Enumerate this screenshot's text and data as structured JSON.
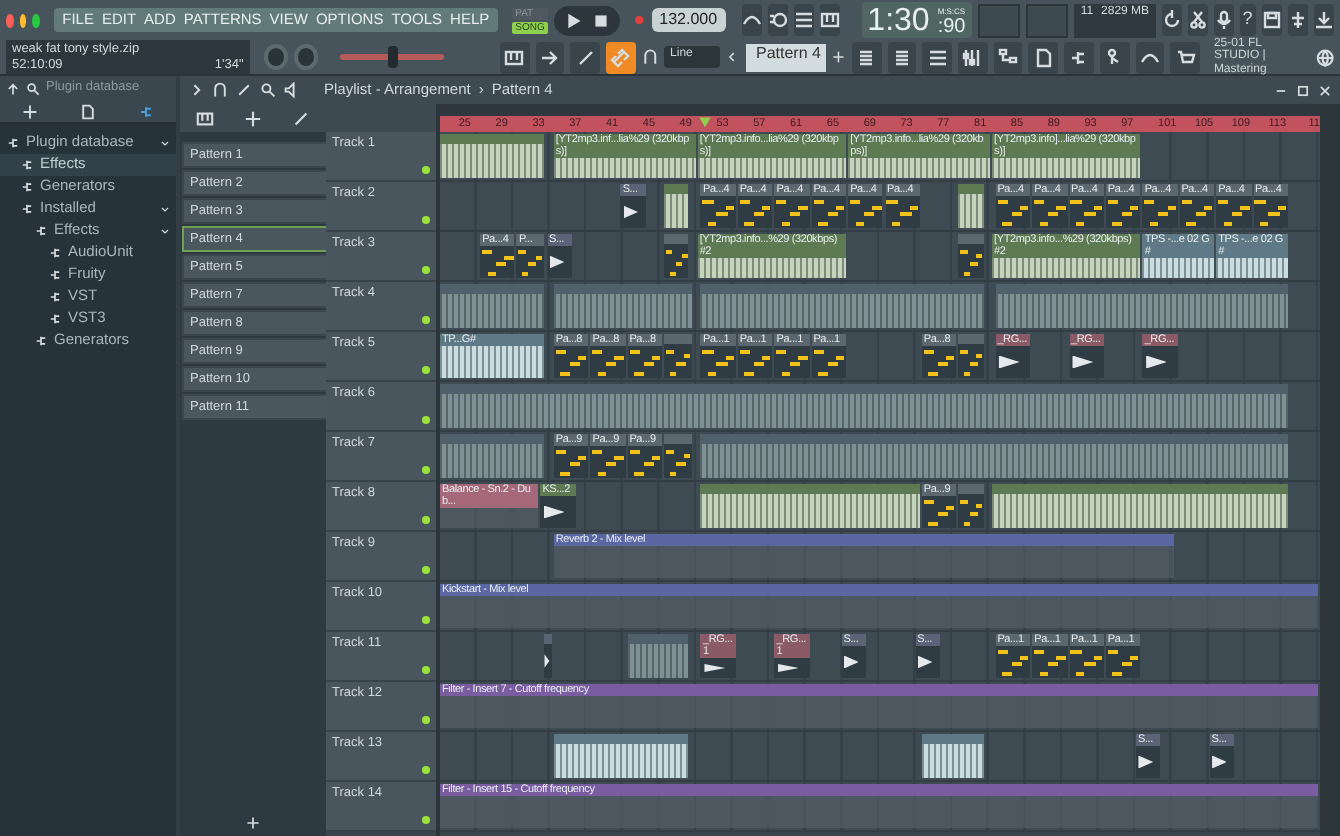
{
  "menu": [
    "FILE",
    "EDIT",
    "ADD",
    "PATTERNS",
    "VIEW",
    "OPTIONS",
    "TOOLS",
    "HELP"
  ],
  "modes": [
    {
      "label": "PAT",
      "selected": false
    },
    {
      "label": "SONG",
      "selected": true
    }
  ],
  "tempo": "132.000",
  "time": {
    "main": "1:30",
    "sub": ":90",
    "unit": "M:S:CS"
  },
  "monitor": {
    "cpu": "11",
    "memory": "2829 MB"
  },
  "help_glyph": "?",
  "hint_panel": {
    "title": "weak fat tony style.zip",
    "time": "52:10:09",
    "length": "1'34\""
  },
  "master_pitch": {
    "level": 0.5
  },
  "snap_tools": [
    {
      "on": false
    },
    {
      "on": false
    },
    {
      "on": false
    },
    {
      "on": true
    }
  ],
  "snap": {
    "value": "Line"
  },
  "pattern_selector": {
    "value": "Pattern 4"
  },
  "news": {
    "title": "25-01 FL STUDIO |",
    "subtitle": "Mastering"
  },
  "browser": {
    "breadcrumb": "Plugin database",
    "tree": [
      {
        "label": "Plugin database",
        "expanded": true,
        "selected": false,
        "children": [
          {
            "label": "Effects",
            "selected": true
          },
          {
            "label": "Generators",
            "selected": false
          },
          {
            "label": "Installed",
            "expanded": true,
            "selected": false,
            "children": [
              {
                "label": "Effects",
                "expanded": true,
                "selected": false,
                "children": [
                  {
                    "label": "AudioUnit",
                    "selected": false
                  },
                  {
                    "label": "Fruity",
                    "selected": false
                  },
                  {
                    "label": "VST",
                    "selected": false
                  },
                  {
                    "label": "VST3",
                    "selected": false
                  }
                ]
              },
              {
                "label": "Generators",
                "selected": false
              }
            ]
          }
        ]
      }
    ]
  },
  "playlist": {
    "title": "Playlist - Arrangement",
    "separator": "›",
    "pattern": "Pattern 4",
    "patterns": [
      {
        "label": "Pattern 1",
        "selected": false
      },
      {
        "label": "Pattern 2",
        "selected": false
      },
      {
        "label": "Pattern 3",
        "selected": false
      },
      {
        "label": "Pattern 4",
        "selected": true
      },
      {
        "label": "Pattern 5",
        "selected": false
      },
      {
        "label": "Pattern 7",
        "selected": false
      },
      {
        "label": "Pattern 8",
        "selected": false
      },
      {
        "label": "Pattern 9",
        "selected": false
      },
      {
        "label": "Pattern 10",
        "selected": false
      },
      {
        "label": "Pattern 11",
        "selected": false
      }
    ],
    "ruler": [
      "25",
      "29",
      "33",
      "37",
      "41",
      "45",
      "49",
      "53",
      "57",
      "61",
      "65",
      "69",
      "73",
      "77",
      "81",
      "85",
      "89",
      "93",
      "97",
      "101",
      "105",
      "109",
      "113",
      "11"
    ],
    "tracks": [
      {
        "name": "Track 1",
        "enabled": true,
        "clips": [
          {
            "kind": "audio",
            "color": "#5d7a52"
          },
          {
            "kind": "audio",
            "color": "#5d7a52",
            "label": "[YT2mp3.inf...lia%29 (320kbps)]"
          },
          {
            "kind": "audio",
            "color": "#5d7a52",
            "label": "[YT2mp3.info...lia%29 (320kbps)]"
          },
          {
            "kind": "audio",
            "color": "#5d7a52",
            "label": "[YT2mp3.info...lia%29 (320kbps)]"
          },
          {
            "kind": "audio",
            "color": "#5d7a52",
            "label": "[YT2mp3.info]...lia%29 (320kbps)]"
          }
        ]
      },
      {
        "name": "Track 2",
        "enabled": true,
        "clips": [
          {
            "kind": "sample",
            "color": "#5a6476",
            "label": "S..."
          },
          {
            "kind": "audio",
            "color": "#5d7a52"
          },
          {
            "kind": "pattern",
            "color": "#5c6870",
            "label": "Pa...4"
          },
          {
            "kind": "pattern",
            "color": "#5c6870",
            "label": "Pa...4"
          },
          {
            "kind": "pattern",
            "color": "#5c6870",
            "label": "Pa...4"
          },
          {
            "kind": "pattern",
            "color": "#5c6870",
            "label": "Pa...4"
          },
          {
            "kind": "pattern",
            "color": "#5c6870",
            "label": "Pa...4"
          },
          {
            "kind": "pattern",
            "color": "#5c6870",
            "label": "Pa...4"
          },
          {
            "kind": "audio",
            "color": "#5d7a52"
          },
          {
            "kind": "pattern",
            "color": "#5c6870",
            "label": "Pa...4"
          },
          {
            "kind": "pattern",
            "color": "#5c6870",
            "label": "Pa...4"
          },
          {
            "kind": "pattern",
            "color": "#5c6870",
            "label": "Pa...4"
          },
          {
            "kind": "pattern",
            "color": "#5c6870",
            "label": "Pa...4"
          },
          {
            "kind": "pattern",
            "color": "#5c6870",
            "label": "Pa...4"
          },
          {
            "kind": "pattern",
            "color": "#5c6870",
            "label": "Pa...4"
          },
          {
            "kind": "pattern",
            "color": "#5c6870",
            "label": "Pa...4"
          },
          {
            "kind": "pattern",
            "color": "#5c6870",
            "label": "Pa...4"
          }
        ]
      },
      {
        "name": "Track 3",
        "enabled": true,
        "clips": [
          {
            "kind": "pattern",
            "color": "#5c6870",
            "label": "Pa...4"
          },
          {
            "kind": "pattern",
            "color": "#5c6870",
            "label": "P..."
          },
          {
            "kind": "sample",
            "color": "#5a6476",
            "label": "S..."
          },
          {
            "kind": "pattern",
            "color": "#5c6870"
          },
          {
            "kind": "audio",
            "color": "#5d7a52",
            "label": "[YT2mp3.info...%29 (320kbps) #2"
          },
          {
            "kind": "pattern",
            "color": "#5c6870"
          },
          {
            "kind": "audio",
            "color": "#5d7a52",
            "label": "[YT2mp3.info...%29 (320kbps) #2"
          },
          {
            "kind": "audio",
            "color": "#5f7a86",
            "label": "TPS -...e 02 G#"
          },
          {
            "kind": "audio",
            "color": "#5f7a86",
            "label": "TPS -...e 02 G#"
          }
        ]
      },
      {
        "name": "Track 4",
        "enabled": true,
        "clips": [
          {
            "kind": "audio",
            "color": "#50616b"
          },
          {
            "kind": "audio",
            "color": "#50616b"
          },
          {
            "kind": "audio",
            "color": "#50616b"
          },
          {
            "kind": "audio",
            "color": "#50616b"
          }
        ]
      },
      {
        "name": "Track 5",
        "enabled": true,
        "clips": [
          {
            "kind": "audio",
            "color": "#5f7a86",
            "label": "TP...G#"
          },
          {
            "kind": "pattern",
            "color": "#5c6870",
            "label": "Pa...8"
          },
          {
            "kind": "pattern",
            "color": "#5c6870",
            "label": "Pa...8"
          },
          {
            "kind": "pattern",
            "color": "#5c6870",
            "label": "Pa...8"
          },
          {
            "kind": "pattern",
            "color": "#5c6870"
          },
          {
            "kind": "pattern",
            "color": "#5c6870",
            "label": "Pa...1"
          },
          {
            "kind": "pattern",
            "color": "#5c6870",
            "label": "Pa...1"
          },
          {
            "kind": "pattern",
            "color": "#5c6870",
            "label": "Pa...1"
          },
          {
            "kind": "pattern",
            "color": "#5c6870",
            "label": "Pa...1"
          },
          {
            "kind": "pattern",
            "color": "#5c6870",
            "label": "Pa...8"
          },
          {
            "kind": "pattern",
            "color": "#5c6870"
          },
          {
            "kind": "sample",
            "color": "#8a5a66",
            "label": "_RG..."
          },
          {
            "kind": "sample",
            "color": "#8a5a66",
            "label": "_RG..."
          },
          {
            "kind": "sample",
            "color": "#8a5a66",
            "label": "_RG..."
          }
        ]
      },
      {
        "name": "Track 6",
        "enabled": true,
        "clips": [
          {
            "kind": "audio",
            "color": "#50616b"
          }
        ]
      },
      {
        "name": "Track 7",
        "enabled": true,
        "clips": [
          {
            "kind": "audio",
            "color": "#50616b"
          },
          {
            "kind": "pattern",
            "color": "#5c6870",
            "label": "Pa...9"
          },
          {
            "kind": "pattern",
            "color": "#5c6870",
            "label": "Pa...9"
          },
          {
            "kind": "pattern",
            "color": "#5c6870",
            "label": "Pa...9"
          },
          {
            "kind": "pattern",
            "color": "#5c6870"
          },
          {
            "kind": "audio",
            "color": "#50616b"
          }
        ]
      },
      {
        "name": "Track 8",
        "enabled": true,
        "clips": [
          {
            "kind": "automation",
            "color": "#a5677a",
            "label": "Balance - Sn.2 - Dub..."
          },
          {
            "kind": "sample",
            "color": "#5d7a52",
            "label": "KS...2"
          },
          {
            "kind": "audio",
            "color": "#5d7a52"
          },
          {
            "kind": "pattern",
            "color": "#5c6870",
            "label": "Pa...9"
          },
          {
            "kind": "pattern",
            "color": "#5c6870"
          },
          {
            "kind": "audio",
            "color": "#5d7a52"
          }
        ]
      },
      {
        "name": "Track 9",
        "enabled": true,
        "clips": [
          {
            "kind": "automation",
            "color": "#5a67a3",
            "label": "Reverb 2 - Mix level"
          }
        ]
      },
      {
        "name": "Track 10",
        "enabled": true,
        "clips": [
          {
            "kind": "automation",
            "color": "#5a67a3",
            "label": "Kickstart - Mix level"
          }
        ]
      },
      {
        "name": "Track 11",
        "enabled": true,
        "clips": [
          {
            "kind": "sample",
            "color": "#5a6476"
          },
          {
            "kind": "audio",
            "color": "#50616b"
          },
          {
            "kind": "sample",
            "color": "#8a5a66",
            "label": "_RG...1"
          },
          {
            "kind": "sample",
            "color": "#8a5a66",
            "label": "_RG...1"
          },
          {
            "kind": "sample",
            "color": "#5a6476",
            "label": "S..."
          },
          {
            "kind": "sample",
            "color": "#5a6476",
            "label": "S..."
          },
          {
            "kind": "pattern",
            "color": "#5c6870",
            "label": "Pa...1"
          },
          {
            "kind": "pattern",
            "color": "#5c6870",
            "label": "Pa...1"
          },
          {
            "kind": "pattern",
            "color": "#5c6870",
            "label": "Pa...1"
          },
          {
            "kind": "pattern",
            "color": "#5c6870",
            "label": "Pa...1"
          }
        ]
      },
      {
        "name": "Track 12",
        "enabled": true,
        "clips": [
          {
            "kind": "automation",
            "color": "#7a5ca0",
            "label": "Filter - Insert 7 - Cutoff frequency"
          }
        ]
      },
      {
        "name": "Track 13",
        "enabled": true,
        "clips": [
          {
            "kind": "audio",
            "color": "#5f7a86"
          },
          {
            "kind": "audio",
            "color": "#5f7a86"
          },
          {
            "kind": "sample",
            "color": "#5a6476",
            "label": "S..."
          },
          {
            "kind": "sample",
            "color": "#5a6476",
            "label": "S..."
          }
        ]
      },
      {
        "name": "Track 14",
        "enabled": true,
        "clips": [
          {
            "kind": "automation",
            "color": "#7a5ca0",
            "label": "Filter - Insert 15 - Cutoff frequency"
          }
        ]
      }
    ]
  }
}
